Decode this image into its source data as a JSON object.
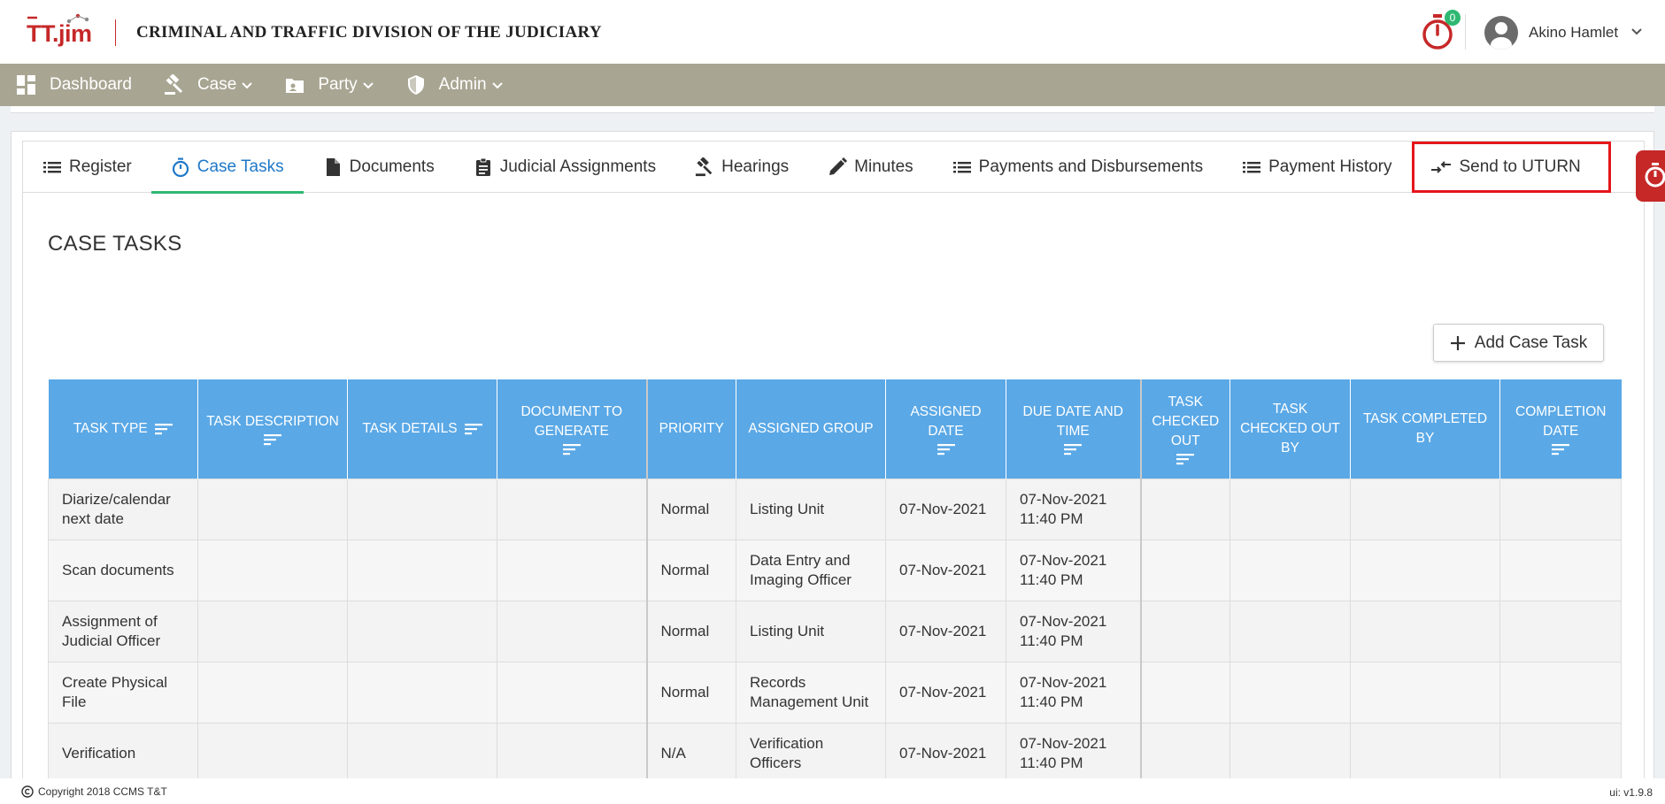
{
  "header": {
    "logo_text": "TT.jim",
    "app_title": "CRIMINAL AND TRAFFIC DIVISION OF THE JUDICIARY",
    "timer_badge": "0",
    "user_name": "Akino Hamlet"
  },
  "nav": {
    "items": [
      {
        "label": "Dashboard",
        "icon": "dashboard-icon",
        "has_dropdown": false
      },
      {
        "label": "Case",
        "icon": "gavel-icon",
        "has_dropdown": true
      },
      {
        "label": "Party",
        "icon": "contact-card-icon",
        "has_dropdown": true
      },
      {
        "label": "Admin",
        "icon": "shield-icon",
        "has_dropdown": true
      }
    ]
  },
  "tabs": [
    {
      "label": "Register",
      "icon": "list-icon"
    },
    {
      "label": "Case Tasks",
      "icon": "stopwatch-icon",
      "active": true
    },
    {
      "label": "Documents",
      "icon": "document-icon"
    },
    {
      "label": "Judicial Assignments",
      "icon": "clipboard-icon"
    },
    {
      "label": "Hearings",
      "icon": "gavel-icon"
    },
    {
      "label": "Minutes",
      "icon": "pencil-icon"
    },
    {
      "label": "Payments and Disbursements",
      "icon": "list-icon"
    },
    {
      "label": "Payment History",
      "icon": "list-icon"
    },
    {
      "label": "Send to UTURN",
      "icon": "swap-arrows-icon",
      "highlighted": true
    }
  ],
  "section_title": "CASE TASKS",
  "add_button_label": "Add Case Task",
  "table": {
    "columns": [
      "TASK TYPE",
      "TASK DESCRIPTION",
      "TASK DETAILS",
      "DOCUMENT TO GENERATE",
      "PRIORITY",
      "ASSIGNED GROUP",
      "ASSIGNED DATE",
      "DUE DATE AND TIME",
      "TASK CHECKED OUT",
      "TASK CHECKED OUT BY",
      "TASK COMPLETED BY",
      "COMPLETION DATE"
    ],
    "rows": [
      {
        "task_type": "Diarize/calendar next date",
        "task_description": "",
        "task_details": "",
        "document": "",
        "priority": "Normal",
        "group": "Listing Unit",
        "assigned_date": "07-Nov-2021",
        "due": "07-Nov-2021 11:40 PM",
        "checked_out": "",
        "checked_out_by": "",
        "completed_by": "",
        "completion_date": ""
      },
      {
        "task_type": "Scan documents",
        "task_description": "",
        "task_details": "",
        "document": "",
        "priority": "Normal",
        "group": "Data Entry and Imaging Officer",
        "assigned_date": "07-Nov-2021",
        "due": "07-Nov-2021 11:40 PM",
        "checked_out": "",
        "checked_out_by": "",
        "completed_by": "",
        "completion_date": ""
      },
      {
        "task_type": "Assignment of Judicial Officer",
        "task_description": "",
        "task_details": "",
        "document": "",
        "priority": "Normal",
        "group": "Listing Unit",
        "assigned_date": "07-Nov-2021",
        "due": "07-Nov-2021 11:40 PM",
        "checked_out": "",
        "checked_out_by": "",
        "completed_by": "",
        "completion_date": ""
      },
      {
        "task_type": "Create Physical File",
        "task_description": "",
        "task_details": "",
        "document": "",
        "priority": "Normal",
        "group": "Records Management Unit",
        "assigned_date": "07-Nov-2021",
        "due": "07-Nov-2021 11:40 PM",
        "checked_out": "",
        "checked_out_by": "",
        "completed_by": "",
        "completion_date": ""
      },
      {
        "task_type": "Verification",
        "task_description": "",
        "task_details": "",
        "document": "",
        "priority": "N/A",
        "group": "Verification Officers",
        "assigned_date": "07-Nov-2021",
        "due": "07-Nov-2021 11:40 PM",
        "checked_out": "",
        "checked_out_by": "",
        "completed_by": "",
        "completion_date": ""
      }
    ]
  },
  "footer": {
    "copyright": "Copyright 2018  CCMS T&T",
    "version": "ui: v1.9.8"
  },
  "colors": {
    "nav_bg": "#a8a592",
    "table_header": "#5aa8e6",
    "active_tab_text": "#1f78c8",
    "active_tab_underline": "#2eb872",
    "brand_red": "#c62828",
    "highlight_box": "#e5161b"
  }
}
